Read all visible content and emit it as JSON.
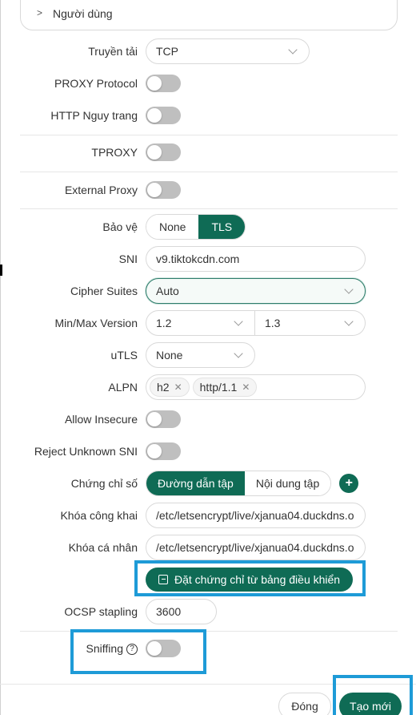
{
  "users_section": {
    "label": "Người dùng"
  },
  "transport": {
    "label": "Truyền tải",
    "value": "TCP"
  },
  "proxy_protocol": {
    "label": "PROXY Protocol"
  },
  "http_camouflage": {
    "label": "HTTP Nguy trang"
  },
  "tproxy": {
    "label": "TPROXY"
  },
  "external_proxy": {
    "label": "External Proxy"
  },
  "security": {
    "label": "Bảo vệ",
    "options": [
      "None",
      "TLS"
    ],
    "selected": "TLS"
  },
  "sni": {
    "label": "SNI",
    "value": "v9.tiktokcdn.com"
  },
  "cipher_suites": {
    "label": "Cipher Suites",
    "value": "Auto"
  },
  "min_max_version": {
    "label": "Min/Max Version",
    "min": "1.2",
    "max": "1.3"
  },
  "utls": {
    "label": "uTLS",
    "value": "None"
  },
  "alpn": {
    "label": "ALPN",
    "tags": [
      "h2",
      "http/1.1"
    ]
  },
  "allow_insecure": {
    "label": "Allow Insecure"
  },
  "reject_unknown_sni": {
    "label": "Reject Unknown SNI"
  },
  "certificate": {
    "label": "Chứng chỉ số",
    "options": [
      "Đường dẫn tập",
      "Nội dung tập"
    ],
    "selected": "Đường dẫn tập",
    "add_symbol": "+"
  },
  "public_key": {
    "label": "Khóa công khai",
    "value": "/etc/letsencrypt/live/xjanua04.duckdns.o"
  },
  "private_key": {
    "label": "Khóa cá nhân",
    "value": "/etc/letsencrypt/live/xjanua04.duckdns.o"
  },
  "set_cert_button": {
    "label": "Đặt chứng chỉ từ bảng điều khiển"
  },
  "ocsp": {
    "label": "OCSP stapling",
    "value": "3600"
  },
  "sniffing": {
    "label": "Sniffing",
    "help_symbol": "?"
  },
  "footer": {
    "close_label": "Đóng",
    "create_label": "Tạo mới"
  },
  "colors": {
    "primary": "#0f6b55",
    "highlight": "#1e9bd7",
    "toggle_off": "#bfbfbf"
  }
}
